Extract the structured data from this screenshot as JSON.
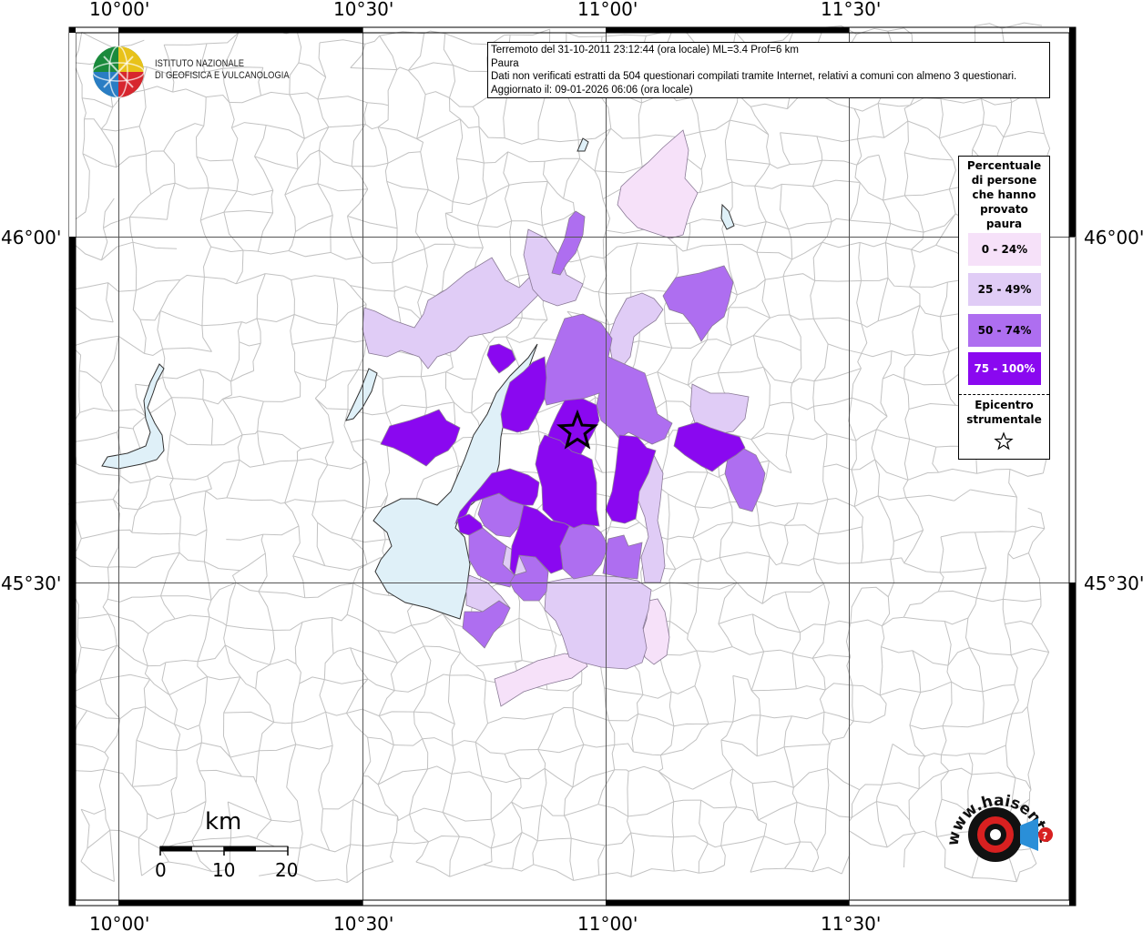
{
  "info_box": {
    "line1": "Terremoto del 31-10-2011 23:12:44 (ora locale) ML=3.4 Prof=6 km",
    "line2": "Paura",
    "line3": "Dati non verificati estratti da 504 questionari compilati tramite Internet, relativi a comuni con almeno 3 questionari.",
    "line4": "Aggiornato il: 09-01-2026 06:06 (ora locale)"
  },
  "axes": {
    "longitude_ticks": [
      "10°00'",
      "10°30'",
      "11°00'",
      "11°30'"
    ],
    "latitude_ticks": [
      "46°00'",
      "45°30'"
    ]
  },
  "legend": {
    "title": "Percentuale di persone che hanno provato paura",
    "classes": [
      {
        "label": "0 - 24%",
        "color": "#f6e1f9"
      },
      {
        "label": "25 - 49%",
        "color": "#e0ccf6"
      },
      {
        "label": "50 - 74%",
        "color": "#ae6ef0"
      },
      {
        "label": "75 - 100%",
        "color": "#8a08f0"
      }
    ],
    "epicenter_label": "Epicentro strumentale"
  },
  "logos": {
    "ingv_line1": "ISTITUTO NAZIONALE",
    "ingv_line2": "DI GEOFISICA E VULCANOLOGIA",
    "hst_text": "www.haisentitoilterremoto.it"
  },
  "scale_bar": {
    "unit": "km",
    "labels": [
      "0",
      "10",
      "20"
    ]
  },
  "colors": {
    "lake": "#dff0f8",
    "boundary": "#b8b8b8",
    "grid": "#555555",
    "frame": "#000000"
  }
}
